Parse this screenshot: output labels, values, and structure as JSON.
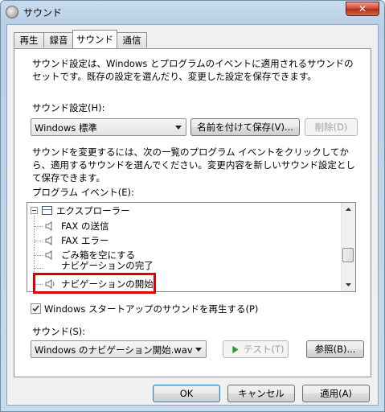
{
  "window": {
    "title": "サウンド",
    "close_label": "✕"
  },
  "tabs": [
    {
      "label": "再生"
    },
    {
      "label": "録音"
    },
    {
      "label": "サウンド"
    },
    {
      "label": "通信"
    }
  ],
  "panel": {
    "description": "サウンド設定は、Windows とプログラムのイベントに適用されるサウンドのセットです。既存の設定を選んだり、変更した設定を保存できます。",
    "scheme_label": "サウンド設定(H):",
    "scheme_value": "Windows 標準",
    "save_as_label": "名前を付けて保存(V)...",
    "delete_label": "削除(D)",
    "change_description": "サウンドを変更するには、次の一覧のプログラム イベントをクリックしてから、適用するサウンドを選んでください。変更内容を新しいサウンド設定として保存できます。",
    "events_label": "プログラム イベント(E):",
    "events": [
      {
        "label": "エクスプローラー"
      },
      {
        "label": "FAX の送信"
      },
      {
        "label": "FAX エラー"
      },
      {
        "label": "ごみ箱を空にする"
      },
      {
        "label": "ナビゲーションの完了"
      },
      {
        "label": "ナビゲーションの開始"
      }
    ],
    "startup_checkbox_label": "Windows スタートアップのサウンドを再生する(P)",
    "startup_checked": true,
    "sound_label": "サウンド(S):",
    "sound_value": "Windows のナビゲーション開始.wav",
    "test_label": "テスト(T)",
    "browse_label": "参照(B)..."
  },
  "footer": {
    "ok_label": "OK",
    "cancel_label": "キャンセル",
    "apply_label": "適用(A)"
  },
  "colors": {
    "highlight_border": "#e00000",
    "test_icon": "#2f9b2f"
  }
}
